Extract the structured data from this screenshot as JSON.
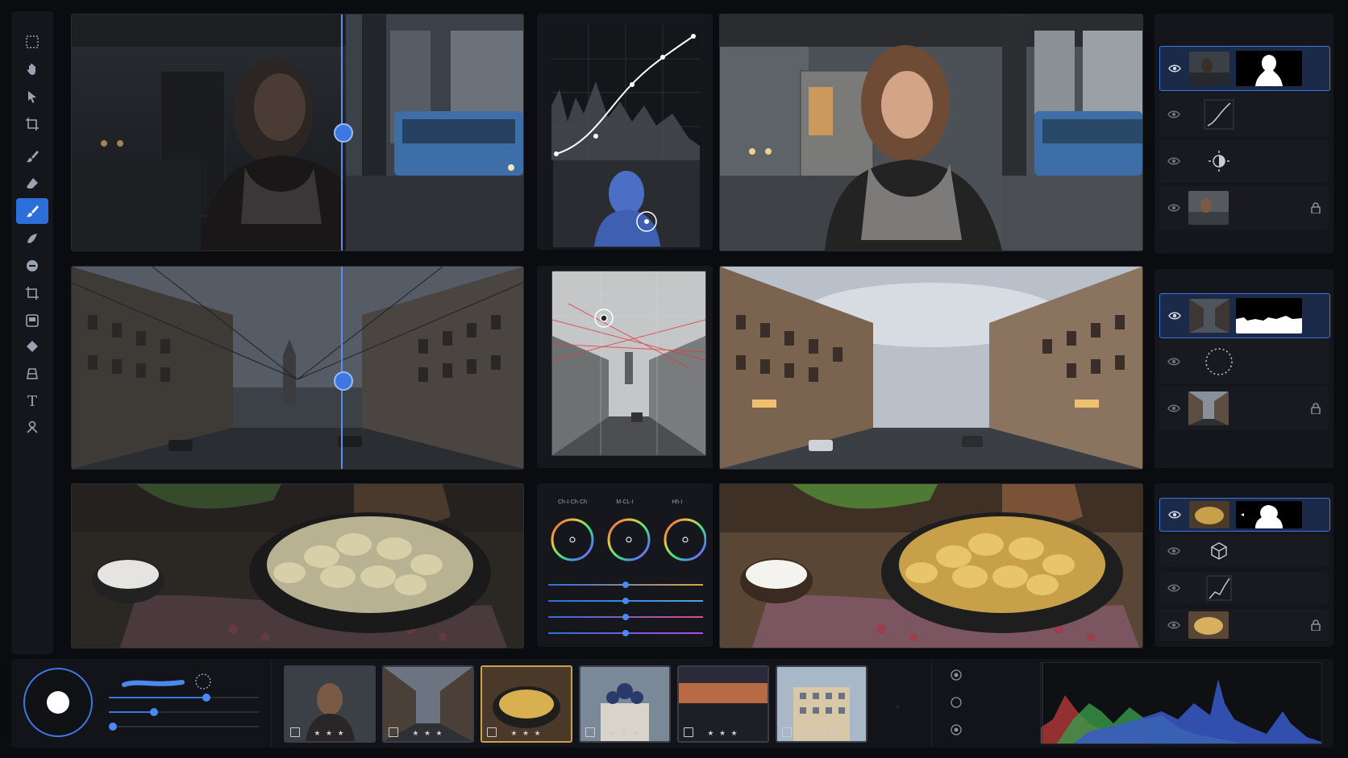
{
  "toolbar": {
    "tools": [
      {
        "icon": "marquee-select-icon"
      },
      {
        "icon": "hand-pan-icon"
      },
      {
        "icon": "pointer-arrow-icon"
      },
      {
        "icon": "artboard-icon"
      },
      {
        "icon": "brush-icon"
      },
      {
        "icon": "eraser-icon"
      },
      {
        "icon": "healing-brush-icon",
        "active": true
      },
      {
        "icon": "patch-tool-icon"
      },
      {
        "icon": "clone-stamp-icon"
      },
      {
        "icon": "crop-icon"
      },
      {
        "icon": "frame-icon"
      },
      {
        "icon": "fill-bucket-icon"
      },
      {
        "icon": "perspective-icon"
      },
      {
        "icon": "text-icon",
        "glyph": "T"
      },
      {
        "icon": "puppet-warp-icon"
      }
    ]
  },
  "colors": {
    "accent": "#3d78e0",
    "panel": "#15171c",
    "background": "#0b0c0f",
    "selected_film_border": "#c9a24a"
  },
  "color_wheels": {
    "labels": [
      "Ch·ℓ·Ch·Ch",
      "M·CL·I",
      "Hh·I"
    ]
  },
  "sliders": [
    {
      "value": 0.5,
      "color": "#e1a24a"
    },
    {
      "value": 0.5,
      "color": "#4aa7e1"
    },
    {
      "value": 0.5,
      "color": "#e14a8a"
    },
    {
      "value": 0.5,
      "color": "#b04ae1"
    }
  ],
  "brush": {
    "size_slider": 0.65,
    "hardness_slider": 0.3,
    "flow_slider": 0.02
  },
  "filmstrip": [
    {
      "name": "portrait",
      "stars": "★ ★ ★"
    },
    {
      "name": "street",
      "stars": "★ ★ ★"
    },
    {
      "name": "dumplings",
      "stars": "★ ★ ★",
      "selected": true
    },
    {
      "name": "cathedral",
      "stars": "★ ★ ★"
    },
    {
      "name": "sunset-city",
      "stars": "★ ★ ★"
    },
    {
      "name": "building",
      "stars": "★ ★ ★"
    }
  ],
  "layers": {
    "panel1": [
      "image-with-mask",
      "curves-adjustment",
      "brightness-adjustment",
      "background-locked"
    ],
    "panel2": [
      "image-with-mask",
      "vignette-adjustment",
      "background-locked"
    ],
    "panel3": [
      "image-with-mask",
      "3d-lut-adjustment",
      "curves-adjustment",
      "background-locked"
    ]
  }
}
